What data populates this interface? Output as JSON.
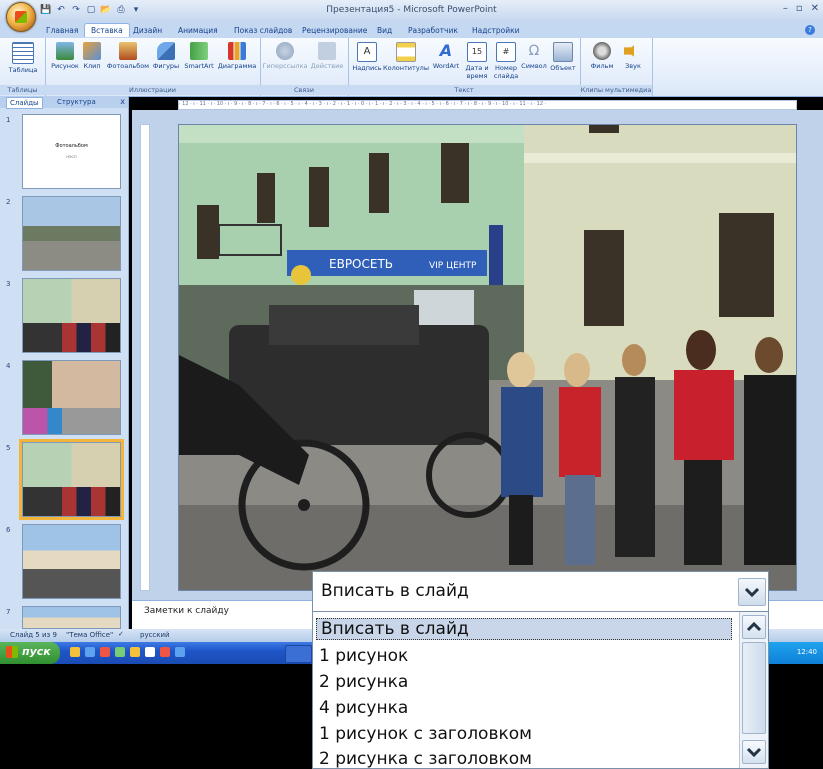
{
  "window": {
    "title": "Презентация5 - Microsoft PowerPoint",
    "min_label": "–",
    "max_label": "▫",
    "close_label": "✕"
  },
  "tabs": [
    "Главная",
    "Вставка",
    "Дизайн",
    "Анимация",
    "Показ слайдов",
    "Рецензирование",
    "Вид",
    "Разработчик",
    "Надстройки"
  ],
  "ribbon": {
    "groups": {
      "tables": "Таблицы",
      "illustrations": "Иллюстрации",
      "links": "Связи",
      "text": "Текст",
      "media": "Клипы мультимедиа"
    },
    "buttons": {
      "table": "Таблица",
      "picture": "Рисунок",
      "clip": "Клип",
      "photoalbum": "Фотоальбом",
      "shapes": "Фигуры",
      "smartart": "SmartArt",
      "chart": "Диаграмма",
      "hyperlink": "Гиперссылка",
      "action": "Действие",
      "textbox": "Надпись",
      "header": "Колонтитулы",
      "wordart": "WordArt",
      "datetime": "Дата и время",
      "slidenumber": "Номер слайда",
      "symbol": "Символ",
      "object": "Объект",
      "movie": "Фильм",
      "sound": "Звук"
    }
  },
  "leftpane": {
    "tab_slides": "Слайды",
    "tab_outline": "Структура",
    "close": "x",
    "thumb1_title": "Фотоальбом",
    "thumb1_sub": "НЭСП",
    "numbers": [
      "1",
      "2",
      "3",
      "4",
      "5",
      "6",
      "7"
    ]
  },
  "notes": {
    "placeholder": "Заметки к слайду"
  },
  "status": {
    "slide": "Слайд 5 из 9",
    "theme": "\"Тема Office\"",
    "lang": "русский"
  },
  "taskbar": {
    "start": "пуск",
    "clock": "12:40"
  },
  "dropdown": {
    "value": "Вписать в слайд",
    "options": [
      "Вписать в слайд",
      "1 рисунок",
      "2 рисунка",
      "4 рисунка",
      "1 рисунок с заголовком",
      "2 рисунка с заголовком"
    ]
  },
  "ruler_text": "· 12 · ı · 11 · ı · 10 · ı · 9 · ı · 8 · ı · 7 · ı · 6 · ı · 5 · ı · 4 · ı · 3 · ı · 2 · ı · 1 · ı · 0 · ı · 1 · ı · 2 · ı · 3 · ı · 4 · ı · 5 · ı · 6 · ı · 7 · ı · 8 · ı · 9 · ı · 10 · ı · 11 · ı · 12 ·",
  "slide_photo": {
    "sign_euro": "ЕВРОСЕТЬ",
    "sign_vip": "VIP ЦЕНТР"
  },
  "colors": {
    "accent": "#15428b",
    "selection": "#f3b43a",
    "ribbon_bg": "#dce8f8"
  }
}
